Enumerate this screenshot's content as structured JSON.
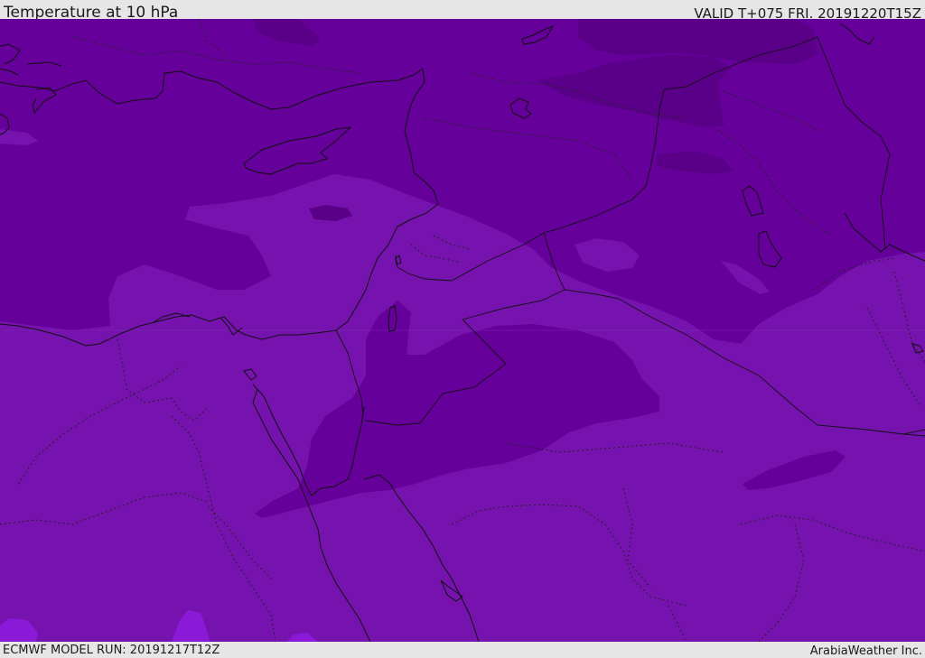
{
  "header": {
    "title": "Temperature at 10 hPa",
    "valid": "VALID T+075 FRI. 20191220T15Z"
  },
  "footer": {
    "model_run": "ECMWF MODEL RUN: 20191217T12Z",
    "credit": "ArabiaWeather Inc."
  },
  "colors": {
    "cold_dark": "#5a0088",
    "cold": "#65009a",
    "mid": "#7612ae",
    "warm_spot": "#8a1ad8",
    "border": "#111111",
    "frame": "#e6e6e6"
  }
}
